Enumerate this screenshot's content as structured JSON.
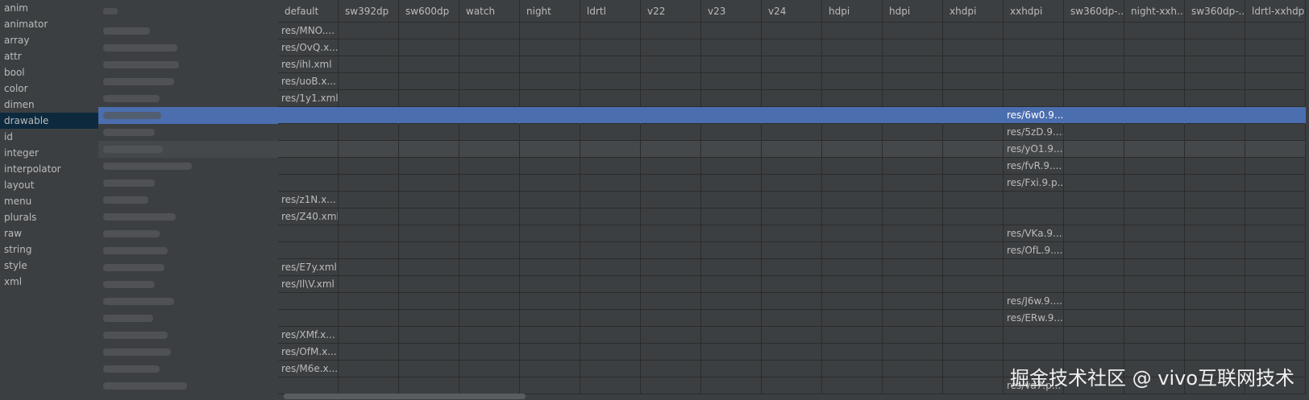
{
  "sidebar": {
    "items": [
      "anim",
      "animator",
      "array",
      "attr",
      "bool",
      "color",
      "dimen",
      "drawable",
      "id",
      "integer",
      "interpolator",
      "layout",
      "menu",
      "plurals",
      "raw",
      "string",
      "style",
      "xml"
    ],
    "selected_index": 7
  },
  "table": {
    "columns": [
      "default",
      "sw392dp",
      "sw600dp",
      "watch",
      "night",
      "ldrtl",
      "v22",
      "v23",
      "v24",
      "hdpi",
      "hdpi",
      "xhdpi",
      "xxhdpi",
      "sw360dp-...",
      "night-xxh...",
      "sw360dp-...",
      "ldrtl-xxhdpi"
    ],
    "rows": [
      {
        "default": "res/MNO....",
        "xxhdpi": ""
      },
      {
        "default": "res/OvQ.x...",
        "xxhdpi": ""
      },
      {
        "default": "res/ihl.xml",
        "xxhdpi": ""
      },
      {
        "default": "res/uoB.x...",
        "xxhdpi": ""
      },
      {
        "default": "res/1y1.xml",
        "xxhdpi": ""
      },
      {
        "default": "",
        "xxhdpi": "res/6w0.9....",
        "state": "selected"
      },
      {
        "default": "",
        "xxhdpi": "res/5zD.9...."
      },
      {
        "default": "",
        "xxhdpi": "res/yO1.9....",
        "state": "hover"
      },
      {
        "default": "",
        "xxhdpi": "res/fvR.9...."
      },
      {
        "default": "",
        "xxhdpi": "res/Fxi.9.p..."
      },
      {
        "default": "res/z1N.x...",
        "xxhdpi": ""
      },
      {
        "default": "res/Z40.xml",
        "xxhdpi": ""
      },
      {
        "default": "",
        "xxhdpi": "res/VKa.9...."
      },
      {
        "default": "",
        "xxhdpi": "res/OfL.9...."
      },
      {
        "default": "res/E7y.xml",
        "xxhdpi": ""
      },
      {
        "default": "res/Il\\V.xml",
        "xxhdpi": ""
      },
      {
        "default": "",
        "xxhdpi": "res/J6w.9...."
      },
      {
        "default": "",
        "xxhdpi": "res/ERw.9...."
      },
      {
        "default": "res/XMf.x...",
        "xxhdpi": ""
      },
      {
        "default": "res/OfM.x...",
        "xxhdpi": ""
      },
      {
        "default": "res/M6e.x...",
        "xxhdpi": ""
      },
      {
        "default": "",
        "xxhdpi": "res/va7.p..."
      }
    ]
  },
  "watermark": "掘金技术社区 @ vivo互联网技术"
}
